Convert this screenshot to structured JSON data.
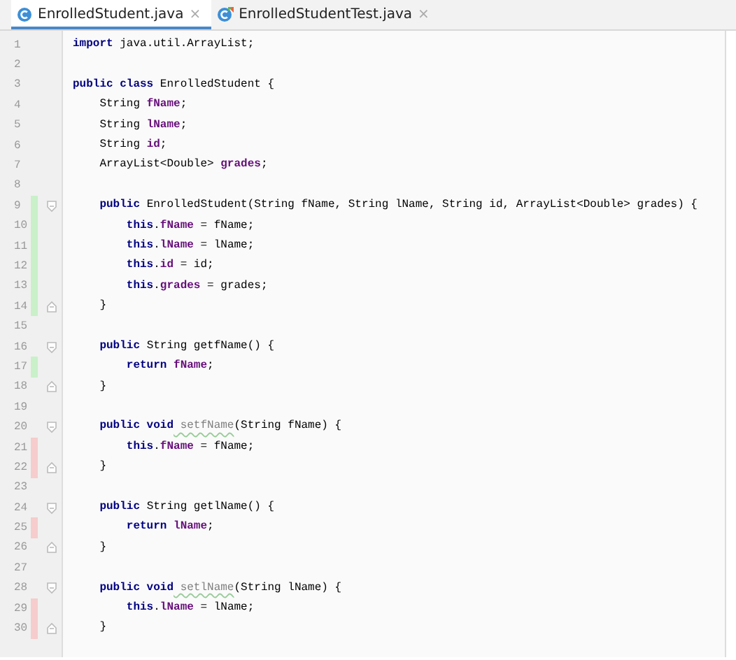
{
  "tabs": [
    {
      "label": "EnrolledStudent.java",
      "selected": true,
      "kind": "class",
      "close": "×"
    },
    {
      "label": "EnrolledStudentTest.java",
      "selected": false,
      "kind": "test",
      "close": "×"
    }
  ],
  "lines": [
    {
      "number": "1",
      "tokens": [
        {
          "t": "import",
          "kind": "kw"
        },
        {
          "t": " java.util.ArrayList;",
          "kind": "plain"
        }
      ]
    },
    {
      "number": "2"
    },
    {
      "number": "3",
      "tokens": [
        {
          "t": "public class",
          "kind": "kw"
        },
        {
          "t": " EnrolledStudent {",
          "kind": "plain"
        }
      ],
      "children": [
        {
          "number": "4",
          "tokens": [
            {
              "t": "String ",
              "kind": "plain"
            },
            {
              "t": "fName",
              "kind": "field"
            },
            {
              "t": ";",
              "kind": "plain"
            }
          ]
        },
        {
          "number": "5",
          "tokens": [
            {
              "t": "String ",
              "kind": "plain"
            },
            {
              "t": "lName",
              "kind": "field"
            },
            {
              "t": ";",
              "kind": "plain"
            }
          ]
        },
        {
          "number": "6",
          "tokens": [
            {
              "t": "String ",
              "kind": "plain"
            },
            {
              "t": "id",
              "kind": "field"
            },
            {
              "t": ";",
              "kind": "plain"
            }
          ]
        },
        {
          "number": "7",
          "tokens": [
            {
              "t": "ArrayList<Double> ",
              "kind": "plain"
            },
            {
              "t": "grades",
              "kind": "field"
            },
            {
              "t": ";",
              "kind": "plain"
            }
          ]
        },
        {
          "number": "8"
        },
        {
          "number": "9",
          "change": {
            "kind": "added"
          },
          "fold": {
            "kind": "start"
          },
          "tokens": [
            {
              "t": "public",
              "kind": "kw"
            },
            {
              "t": " EnrolledStudent(String fName, String lName, String id, ArrayList<Double> grades) {",
              "kind": "plain"
            }
          ],
          "children": [
            {
              "number": "10",
              "change": {
                "kind": "added"
              },
              "tokens": [
                {
                  "t": "this",
                  "kind": "kw"
                },
                {
                  "t": ".",
                  "kind": "plain"
                },
                {
                  "t": "fName",
                  "kind": "field"
                },
                {
                  "t": " = fName;",
                  "kind": "plain"
                }
              ]
            },
            {
              "number": "11",
              "change": {
                "kind": "added"
              },
              "tokens": [
                {
                  "t": "this",
                  "kind": "kw"
                },
                {
                  "t": ".",
                  "kind": "plain"
                },
                {
                  "t": "lName",
                  "kind": "field"
                },
                {
                  "t": " = lName;",
                  "kind": "plain"
                }
              ]
            },
            {
              "number": "12",
              "change": {
                "kind": "added"
              },
              "tokens": [
                {
                  "t": "this",
                  "kind": "kw"
                },
                {
                  "t": ".",
                  "kind": "plain"
                },
                {
                  "t": "id",
                  "kind": "field"
                },
                {
                  "t": " = id;",
                  "kind": "plain"
                }
              ]
            },
            {
              "number": "13",
              "change": {
                "kind": "added"
              },
              "tokens": [
                {
                  "t": "this",
                  "kind": "kw"
                },
                {
                  "t": ".",
                  "kind": "plain"
                },
                {
                  "t": "grades",
                  "kind": "field"
                },
                {
                  "t": " = grades;",
                  "kind": "plain"
                }
              ]
            }
          ]
        },
        {
          "number": "14",
          "change": {
            "kind": "added"
          },
          "fold": {
            "kind": "end"
          },
          "tokens": [
            {
              "t": "}",
              "kind": "plain"
            }
          ]
        },
        {
          "number": "15"
        },
        {
          "number": "16",
          "fold": {
            "kind": "start"
          },
          "tokens": [
            {
              "t": "public",
              "kind": "kw"
            },
            {
              "t": " String getfName() {",
              "kind": "plain"
            }
          ],
          "children": [
            {
              "number": "17",
              "change": {
                "kind": "added"
              },
              "tokens": [
                {
                  "t": "return",
                  "kind": "kw"
                },
                {
                  "t": " fName",
                  "kind": "field"
                },
                {
                  "t": ";",
                  "kind": "plain"
                }
              ]
            }
          ]
        },
        {
          "number": "18",
          "fold": {
            "kind": "end"
          },
          "tokens": [
            {
              "t": "}",
              "kind": "plain"
            }
          ]
        },
        {
          "number": "19"
        },
        {
          "number": "20",
          "fold": {
            "kind": "start"
          },
          "tokens": [
            {
              "t": "public void",
              "kind": "kw"
            },
            {
              "t": " setfName",
              "kind": "unused"
            },
            {
              "t": "(String fName) {",
              "kind": "plain"
            }
          ],
          "children": [
            {
              "number": "21",
              "change": {
                "kind": "removed"
              },
              "tokens": [
                {
                  "t": "this",
                  "kind": "kw"
                },
                {
                  "t": ".",
                  "kind": "plain"
                },
                {
                  "t": "fName",
                  "kind": "field"
                },
                {
                  "t": " = fName;",
                  "kind": "plain"
                }
              ]
            }
          ]
        },
        {
          "number": "22",
          "change": {
            "kind": "removed"
          },
          "fold": {
            "kind": "end"
          },
          "tokens": [
            {
              "t": "}",
              "kind": "plain"
            }
          ]
        },
        {
          "number": "23"
        },
        {
          "number": "24",
          "fold": {
            "kind": "start"
          },
          "tokens": [
            {
              "t": "public",
              "kind": "kw"
            },
            {
              "t": " String getlName() {",
              "kind": "plain"
            }
          ],
          "children": [
            {
              "number": "25",
              "change": {
                "kind": "removed"
              },
              "tokens": [
                {
                  "t": "return",
                  "kind": "kw"
                },
                {
                  "t": " lName",
                  "kind": "field"
                },
                {
                  "t": ";",
                  "kind": "plain"
                }
              ]
            }
          ]
        },
        {
          "number": "26",
          "fold": {
            "kind": "end"
          },
          "tokens": [
            {
              "t": "}",
              "kind": "plain"
            }
          ]
        },
        {
          "number": "27"
        },
        {
          "number": "28",
          "fold": {
            "kind": "start"
          },
          "tokens": [
            {
              "t": "public void",
              "kind": "kw"
            },
            {
              "t": " setlName",
              "kind": "unused"
            },
            {
              "t": "(String lName) {",
              "kind": "plain"
            }
          ],
          "children": [
            {
              "number": "29",
              "change": {
                "kind": "removed"
              },
              "tokens": [
                {
                  "t": "this",
                  "kind": "kw"
                },
                {
                  "t": ".",
                  "kind": "plain"
                },
                {
                  "t": "lName",
                  "kind": "field"
                },
                {
                  "t": " = lName;",
                  "kind": "plain"
                }
              ]
            }
          ]
        },
        {
          "number": "30",
          "change": {
            "kind": "removed"
          },
          "fold": {
            "kind": "end"
          },
          "tokens": [
            {
              "t": "}",
              "kind": "plain"
            }
          ]
        }
      ]
    }
  ]
}
